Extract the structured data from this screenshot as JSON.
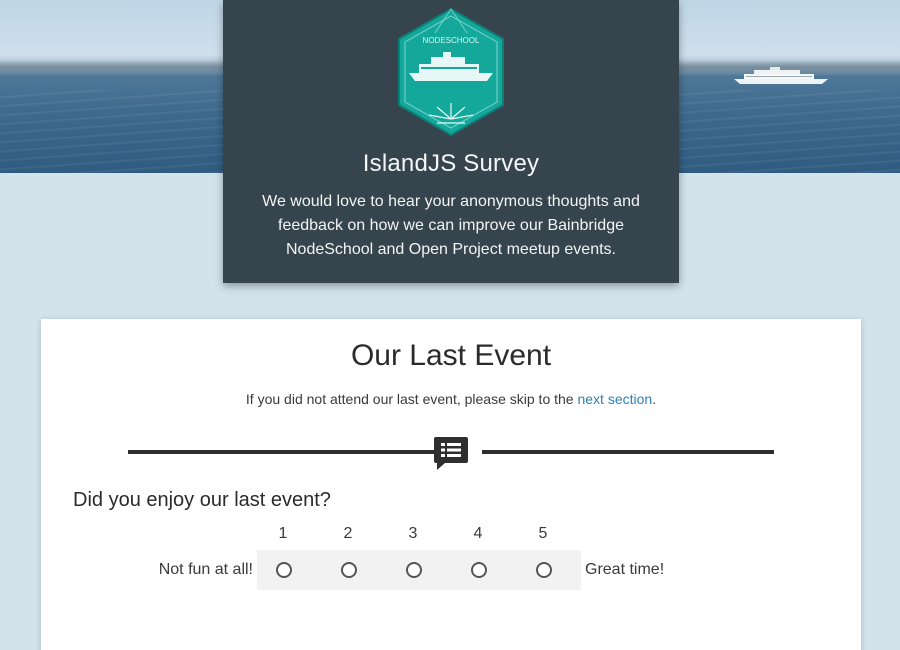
{
  "header": {
    "logo_text": "NODESCHOOL",
    "title": "IslandJS Survey",
    "description": "We would love to hear your anonymous thoughts and feedback on how we can improve our Bainbridge NodeSchool and Open Project meetup events."
  },
  "section": {
    "title": "Our Last Event",
    "note_prefix": "If you did not attend our last event, please skip to the ",
    "note_link": "next section",
    "note_suffix": ".",
    "divider_icon": "comment-list-icon"
  },
  "question": {
    "text": "Did you enjoy our last event?",
    "scale": [
      "1",
      "2",
      "3",
      "4",
      "5"
    ],
    "low_label": "Not fun at all!",
    "high_label": "Great time!"
  },
  "colors": {
    "header_bg": "#36444e",
    "logo_teal": "#14a89b",
    "link": "#2f7fb3",
    "page_bg": "#d3e3ec"
  }
}
